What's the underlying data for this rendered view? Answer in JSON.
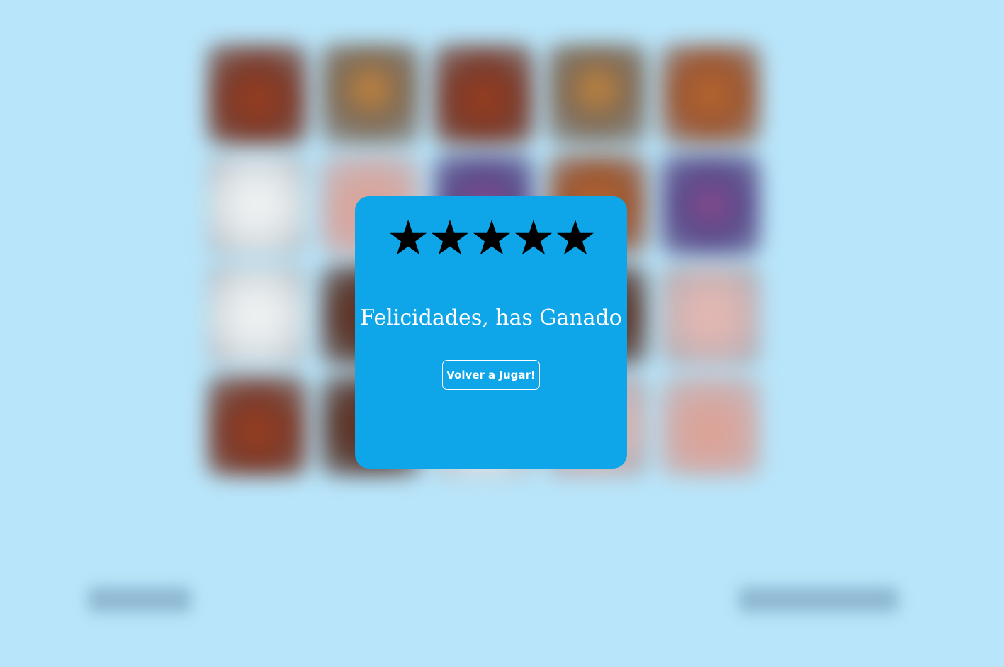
{
  "modal": {
    "stars": [
      "★",
      "★",
      "★",
      "★",
      "★"
    ],
    "rating": 5,
    "title": "Felicidades, has Ganado",
    "replay_label": "Volver a Jugar!"
  },
  "colors": {
    "background": "#b9e5fa",
    "modal": "#0ea5e9",
    "text": "#ffffff",
    "stars": "#000000"
  },
  "board": {
    "icon": "food-card-icon"
  }
}
